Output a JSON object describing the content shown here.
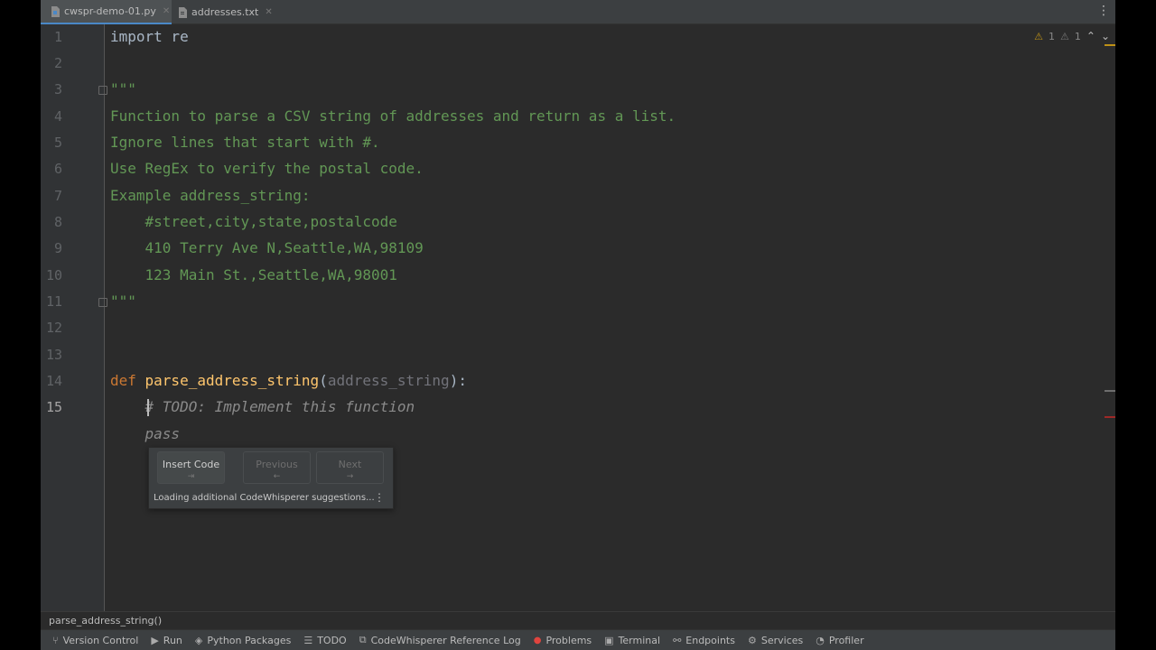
{
  "tabs": [
    {
      "label": "cwspr-demo-01.py",
      "icon": "python-file-icon",
      "active": true
    },
    {
      "label": "addresses.txt",
      "icon": "text-file-icon",
      "active": false
    }
  ],
  "inspections": {
    "warnings": "1",
    "weak_warnings": "1"
  },
  "line_numbers": [
    "1",
    "2",
    "3",
    "4",
    "5",
    "6",
    "7",
    "8",
    "9",
    "10",
    "11",
    "12",
    "13",
    "14",
    "15"
  ],
  "code": {
    "l1": "import re",
    "l3": "\"\"\"",
    "l4": "Function to parse a CSV string of addresses and return as a list.",
    "l5": "Ignore lines that start with #.",
    "l6": "Use RegEx to verify the postal code.",
    "l7": "Example address_string:",
    "l8": "    #street,city,state,postalcode",
    "l9": "    410 Terry Ave N,Seattle,WA,98109",
    "l10": "    123 Main St.,Seattle,WA,98001",
    "l11": "\"\"\"",
    "l14_kw": "def ",
    "l14_fn": "parse_address_string",
    "l14_open": "(",
    "l14_param": "address_string",
    "l14_close": "):",
    "l15_indent": "    ",
    "l15_comment": "# TODO: Implement this function",
    "l16_indent": "    ",
    "l16_ghost": "pass"
  },
  "codewhisperer": {
    "insert_label": "Insert Code",
    "insert_key": "⇥",
    "previous_label": "Previous",
    "previous_key": "←",
    "next_label": "Next",
    "next_key": "→",
    "status": "Loading additional CodeWhisperer suggestions..."
  },
  "breadcrumb": "parse_address_string()",
  "toolbar": [
    {
      "label": "Version Control",
      "icon": "version-control-icon"
    },
    {
      "label": "Run",
      "icon": "run-icon"
    },
    {
      "label": "Python Packages",
      "icon": "packages-icon"
    },
    {
      "label": "TODO",
      "icon": "todo-icon"
    },
    {
      "label": "CodeWhisperer Reference Log",
      "icon": "reference-log-icon"
    },
    {
      "label": "Problems",
      "icon": "problems-icon"
    },
    {
      "label": "Terminal",
      "icon": "terminal-icon"
    },
    {
      "label": "Endpoints",
      "icon": "endpoints-icon"
    },
    {
      "label": "Services",
      "icon": "services-icon"
    },
    {
      "label": "Profiler",
      "icon": "profiler-icon"
    }
  ],
  "colors": {
    "docstring": "#629755",
    "keyword": "#cc7832",
    "function": "#ffc66d",
    "warning": "#be9117",
    "error": "#e0443e"
  }
}
